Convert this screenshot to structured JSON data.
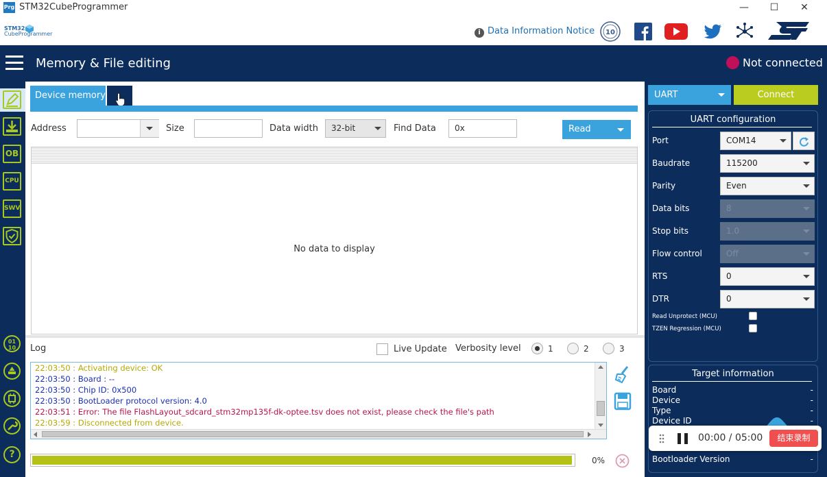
{
  "window": {
    "app_icon_text": "Prg",
    "title": "STM32CubeProgrammer",
    "minimize": "—",
    "maximize": "☐",
    "close": "✕"
  },
  "header": {
    "logo_line1": "STM32",
    "logo_line2": "CubeProgrammer",
    "info_link": "Data Information Notice"
  },
  "topbar": {
    "page_title": "Memory & File editing",
    "connection_status": "Not connected"
  },
  "sidebar": {
    "items": [
      {
        "icon": "pencil-icon",
        "label": ""
      },
      {
        "icon": "download-icon",
        "label": ""
      },
      {
        "icon": "ob-icon",
        "label": "OB"
      },
      {
        "icon": "cpu-icon",
        "label": "CPU"
      },
      {
        "icon": "swv-icon",
        "label": "SWV"
      },
      {
        "icon": "shield-icon",
        "label": ""
      }
    ],
    "bottom_items": [
      {
        "icon": "binary-icon",
        "label": "01\n10"
      },
      {
        "icon": "beta-icon",
        "label": ""
      },
      {
        "icon": "chip-icon",
        "label": ""
      },
      {
        "icon": "wrench-icon",
        "label": ""
      },
      {
        "icon": "help-icon",
        "label": "?"
      }
    ]
  },
  "memory": {
    "tab_label": "Device memory",
    "address_label": "Address",
    "address_value": "",
    "size_label": "Size",
    "size_value": "",
    "data_width_label": "Data width",
    "data_width_value": "32-bit",
    "find_data_label": "Find Data",
    "find_data_value": "0x",
    "read_button": "Read",
    "empty_message": "No data to display"
  },
  "log": {
    "label": "Log",
    "live_update_label": "Live Update",
    "verbosity_label": "Verbosity level",
    "verbosity_options": [
      "1",
      "2",
      "3"
    ],
    "verbosity_selected": "1",
    "lines": [
      {
        "text": "22:03:50 : Activating device: OK",
        "color": "#b5a900"
      },
      {
        "text": "22:03:50 : Board       : --",
        "color": "#1a2fb5"
      },
      {
        "text": "22:03:50 : Chip ID: 0x500",
        "color": "#1a2fb5"
      },
      {
        "text": "22:03:50 : BootLoader protocol version: 4.0",
        "color": "#1a2fb5"
      },
      {
        "text": "22:03:51 : Error: The file FlashLayout_sdcard_stm32mp135f-dk-optee.tsv does not exist, please check the file's path",
        "color": "#b8134f"
      },
      {
        "text": "22:03:59 : Disconnected from device.",
        "color": "#b5a900"
      }
    ],
    "progress_fraction": 0.995,
    "progress_label": "0%"
  },
  "uart": {
    "interface_value": "UART",
    "connect_button": "Connect",
    "config_title": "UART configuration",
    "fields": [
      {
        "label": "Port",
        "value": "COM14",
        "disabled": false
      },
      {
        "label": "Baudrate",
        "value": "115200",
        "disabled": false
      },
      {
        "label": "Parity",
        "value": "Even",
        "disabled": false
      },
      {
        "label": "Data bits",
        "value": "8",
        "disabled": true
      },
      {
        "label": "Stop bits",
        "value": "1.0",
        "disabled": true
      },
      {
        "label": "Flow control",
        "value": "Off",
        "disabled": true
      },
      {
        "label": "RTS",
        "value": "0",
        "disabled": false
      },
      {
        "label": "DTR",
        "value": "0",
        "disabled": false
      }
    ],
    "read_unprotect_label": "Read Unprotect (MCU)",
    "tzen_label": "TZEN Regression (MCU)"
  },
  "target": {
    "title": "Target information",
    "rows": [
      {
        "label": "Board",
        "value": "-"
      },
      {
        "label": "Device",
        "value": "-"
      },
      {
        "label": "Type",
        "value": "-"
      },
      {
        "label": "Device ID",
        "value": "-"
      }
    ],
    "bootloader_label": "Bootloader Version",
    "bootloader_value": "-"
  },
  "recorder": {
    "time": "00:00 / 05:00",
    "stop_label": "结束录制"
  },
  "colors": {
    "navy": "#0c2c5b",
    "accent_blue": "#3aa3dd",
    "accent_green": "#b9cc1f",
    "status_red": "#c10f5a"
  }
}
